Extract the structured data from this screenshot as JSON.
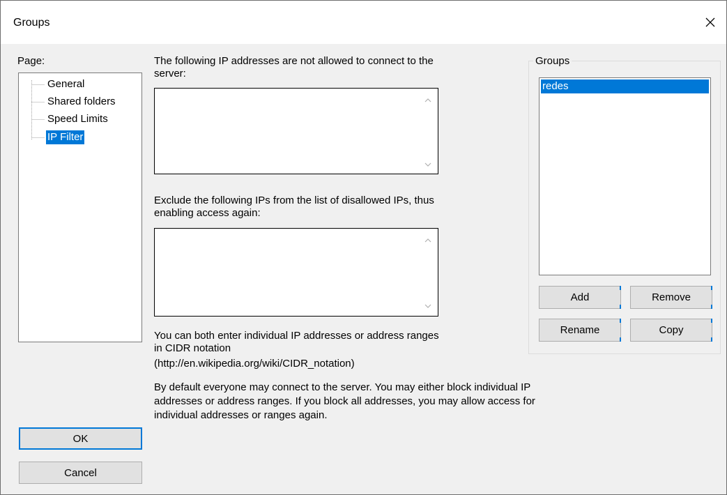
{
  "window": {
    "title": "Groups",
    "close_glyph": "✕"
  },
  "page_label": "Page:",
  "tree": {
    "items": [
      {
        "label": "General"
      },
      {
        "label": "Shared folders"
      },
      {
        "label": "Speed Limits"
      },
      {
        "label": "IP Filter",
        "selected": true
      }
    ]
  },
  "ip_filter": {
    "disallowed_label_line1": "The following IP addresses are not allowed to connect to the",
    "disallowed_label_line2": "server:",
    "disallowed_value": "",
    "exclude_label_line1": "Exclude the following IPs from the list of disallowed IPs, thus",
    "exclude_label_line2": "enabling access again:",
    "exclude_value": "",
    "cidr_note_line1": "You can both enter individual IP addresses or address ranges",
    "cidr_note_line2": "in CIDR notation",
    "cidr_note_line3": "(http://en.wikipedia.org/wiki/CIDR_notation)",
    "default_note_line1": "By default everyone may connect to the server. You may either block individual IP",
    "default_note_line2": "addresses or address ranges. If you block all addresses, you may allow access for",
    "default_note_line3": "individual addresses or ranges again."
  },
  "groups_panel": {
    "legend": "Groups",
    "items": [
      {
        "label": "redes",
        "selected": true
      }
    ],
    "add_label": "Add",
    "remove_label": "Remove",
    "rename_label": "Rename",
    "copy_label": "Copy"
  },
  "footer": {
    "ok_label": "OK",
    "cancel_label": "Cancel"
  },
  "colors": {
    "selection": "#0078d7",
    "dialog_bg": "#f0f0f0",
    "button_bg": "#e1e1e1"
  }
}
